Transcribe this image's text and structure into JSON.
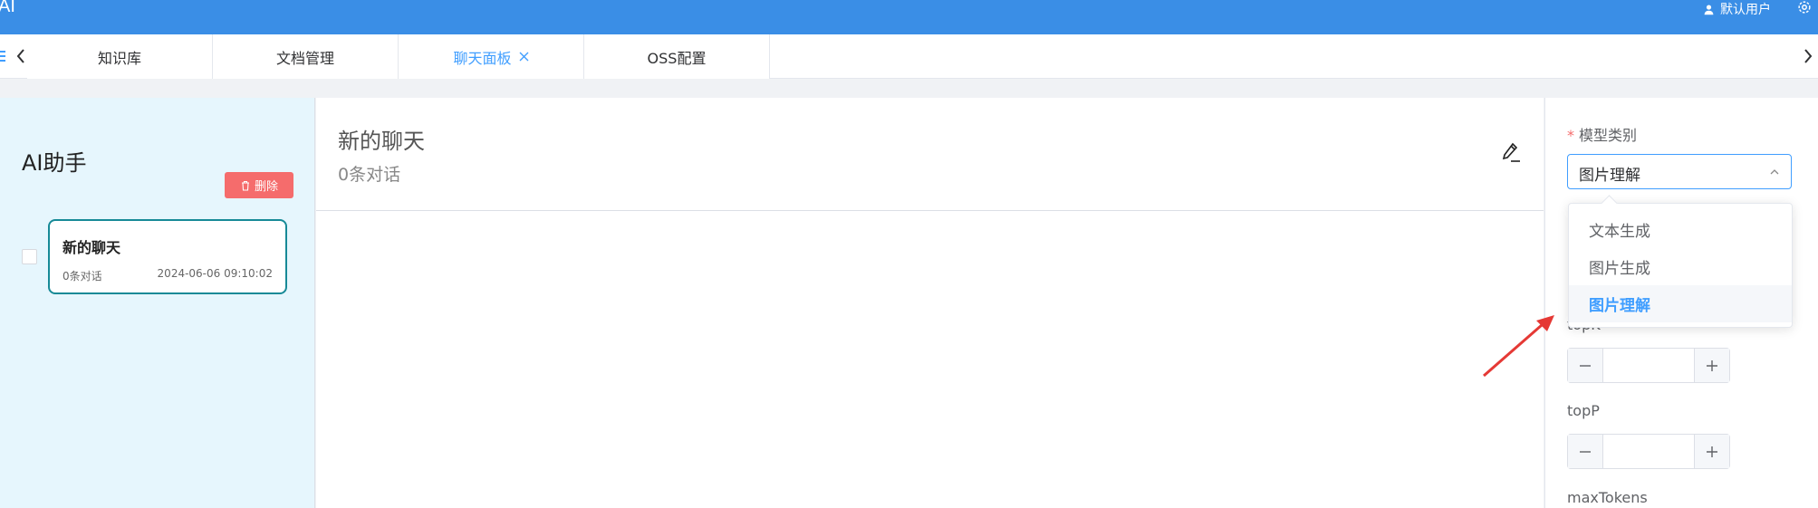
{
  "header": {
    "brand": "AI",
    "user_label": "默认用户"
  },
  "tabs": [
    {
      "label": "知识库",
      "active": false
    },
    {
      "label": "文档管理",
      "active": false
    },
    {
      "label": "聊天面板",
      "active": true
    },
    {
      "label": "OSS配置",
      "active": false
    }
  ],
  "sidebar": {
    "title": "AI助手",
    "delete_label": "删除",
    "chat_list": [
      {
        "name": "新的聊天",
        "count": "0条对话",
        "time": "2024-06-06 09:10:02"
      }
    ]
  },
  "chat": {
    "title": "新的聊天",
    "subtitle": "0条对话"
  },
  "settings": {
    "model_type": {
      "label": "模型类别",
      "required_mark": "*",
      "value": "图片理解",
      "options": [
        "文本生成",
        "图片生成",
        "图片理解"
      ]
    },
    "topk": {
      "label": "topK",
      "value": ""
    },
    "topp": {
      "label": "topP",
      "value": ""
    },
    "max_tokens": {
      "label": "maxTokens"
    }
  },
  "colors": {
    "header_bg": "#3a8ee6",
    "accent": "#409eff",
    "danger": "#f56c6c",
    "sidebar_bg": "#e6f6fd",
    "selected_border": "#178a97",
    "annotation_arrow": "#e53935"
  }
}
